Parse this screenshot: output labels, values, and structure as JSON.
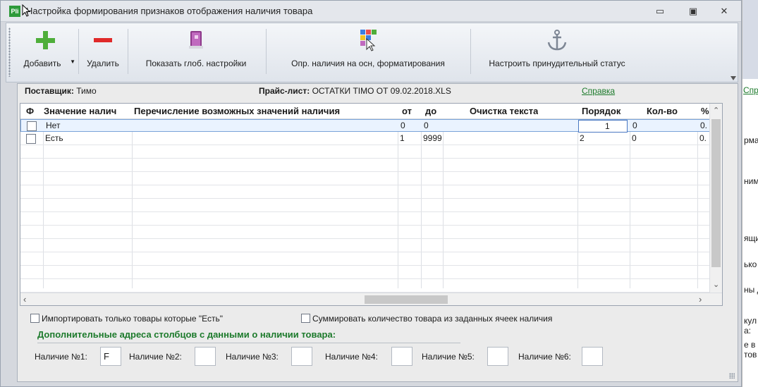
{
  "window": {
    "title": "Настройка формирования признаков отображения наличия товара",
    "icon_text": "Pli",
    "controls": [
      "minimize-icon",
      "maximize-icon",
      "close-icon"
    ],
    "minimize_glyph": "▭",
    "maximize_glyph": "▣",
    "close_glyph": "✕"
  },
  "toolbar": {
    "add": "Добавить",
    "delete": "Удалить",
    "global_settings": "Показать глоб. настройки",
    "availability_formatting": "Опр. наличия на осн, форматирования",
    "force_status": "Настроить принудительный статус"
  },
  "panel": {
    "supplier_label": "Поставщик:",
    "supplier_value": "Тимо",
    "pricelist_label": "Прайс-лист:",
    "pricelist_value": "ОСТАТКИ TIMO ОТ 09.02.2018.XLS",
    "help_link": "Справка"
  },
  "grid": {
    "columns": [
      "Ф",
      "Значение налич",
      "Перечисление возможных значений наличия",
      "от",
      "до",
      "Очистка текста",
      "Порядок",
      "Кол-во",
      "%"
    ],
    "rows": [
      {
        "value": "Нет",
        "enum": "",
        "from": "0",
        "to": "0",
        "cleanup": "",
        "order": "1",
        "qty": "0",
        "pct": "0."
      },
      {
        "value": "Есть",
        "enum": "",
        "from": "1",
        "to": "9999",
        "cleanup": "",
        "order": "2",
        "qty": "0",
        "pct": "0."
      }
    ]
  },
  "options": {
    "import_only_available": "Импортировать только товары которые \"Есть\"",
    "sum_quantity": "Суммировать количество товара из заданных ячеек наличия"
  },
  "addresses": {
    "title": "Дополнительные адреса столбцов с данными о наличии товара:",
    "items": [
      {
        "label": "Наличие №1:",
        "value": "F"
      },
      {
        "label": "Наличие №2:",
        "value": ""
      },
      {
        "label": "Наличие №3:",
        "value": ""
      },
      {
        "label": "Наличие №4:",
        "value": ""
      },
      {
        "label": "Наличие №5:",
        "value": ""
      },
      {
        "label": "Наличие №6:",
        "value": ""
      }
    ]
  },
  "background_app": {
    "link": "Спра",
    "fragments": [
      "рмаі",
      "ним",
      "ящи",
      "ько",
      "ны д",
      "кул",
      "а:",
      "е в",
      "тов"
    ]
  },
  "colors": {
    "accent_green": "#1c7a2b",
    "selection_border": "#4a78c2"
  }
}
